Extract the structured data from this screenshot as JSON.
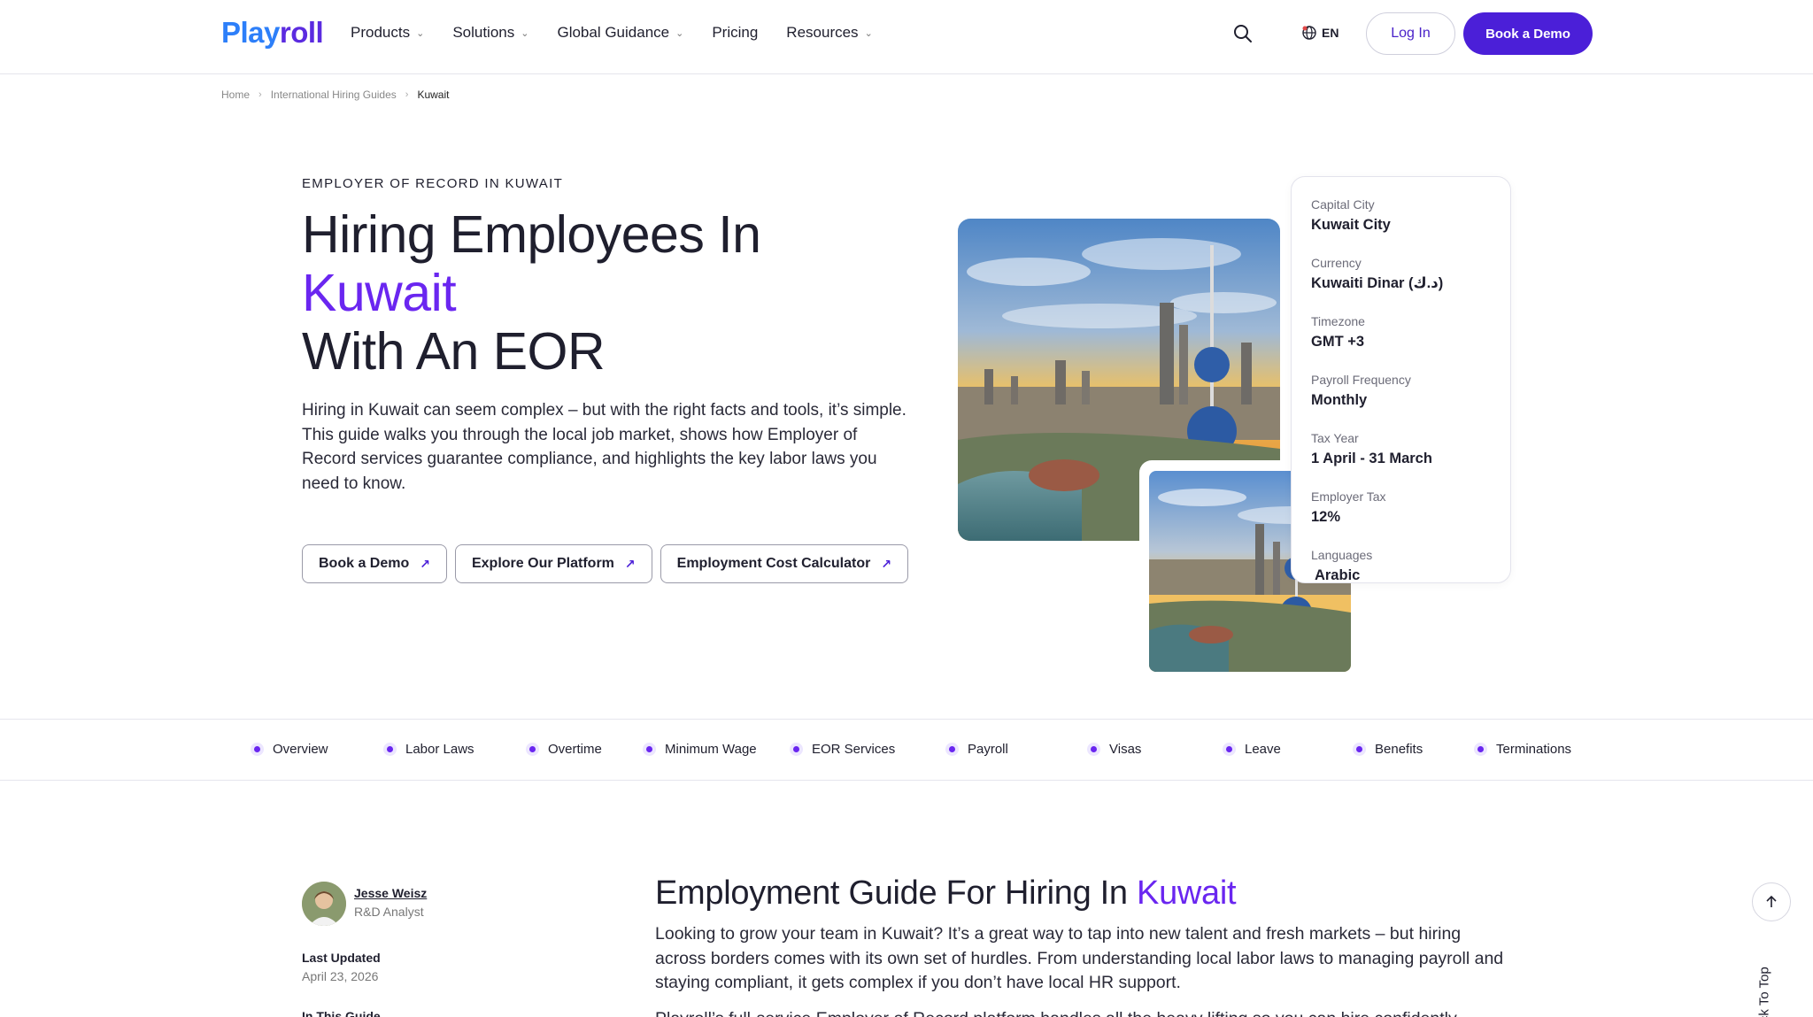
{
  "header": {
    "logo_play": "Play",
    "logo_roll": "roll",
    "nav": [
      {
        "label": "Products",
        "has_dropdown": true
      },
      {
        "label": "Solutions",
        "has_dropdown": true
      },
      {
        "label": "Global Guidance",
        "has_dropdown": true
      },
      {
        "label": "Pricing",
        "has_dropdown": false
      },
      {
        "label": "Resources",
        "has_dropdown": true
      }
    ],
    "language": "EN",
    "login_label": "Log In",
    "demo_label": "Book a Demo"
  },
  "breadcrumb": {
    "items": [
      "Home",
      "International Hiring Guides",
      "Kuwait"
    ]
  },
  "hero": {
    "eyebrow": "EMPLOYER OF RECORD IN KUWAIT",
    "title_line1": "Hiring Employees In",
    "title_accent": "Kuwait",
    "title_line3": "With An EOR",
    "description": "Hiring in Kuwait can seem complex – but with the right facts and tools, it’s simple. This guide walks you through the local job market, shows how Employer of Record services guarantee compliance, and highlights the key labor laws you need to know.",
    "buttons": [
      "Book a Demo",
      "Explore Our Platform",
      "Employment Cost Calculator"
    ]
  },
  "country_info": [
    {
      "label": "Capital City",
      "value": "Kuwait City"
    },
    {
      "label": "Currency",
      "value": "Kuwaiti Dinar (د.ك)"
    },
    {
      "label": "Timezone",
      "value": "GMT +3"
    },
    {
      "label": "Payroll Frequency",
      "value": "Monthly"
    },
    {
      "label": "Tax Year",
      "value": "1 April - 31 March"
    },
    {
      "label": "Employer Tax",
      "value": "12%"
    },
    {
      "label": "Languages",
      "value": " Arabic"
    }
  ],
  "tabs": [
    "Overview",
    "Labor Laws",
    "Overtime",
    "Minimum Wage",
    "EOR Services",
    "Payroll",
    "Visas",
    "Leave",
    "Benefits",
    "Terminations"
  ],
  "author": {
    "name": "Jesse Weisz",
    "role": "R&D Analyst",
    "updated_label": "Last Updated",
    "updated_date": "April 23, 2026",
    "in_this_guide": "In This Guide"
  },
  "guide": {
    "title_prefix": "Employment Guide For Hiring In ",
    "title_accent": "Kuwait",
    "paragraph1": "Looking to grow your team in Kuwait? It’s a great way to tap into new talent and fresh markets – but hiring across borders comes with its own set of hurdles. From understanding local labor laws to managing payroll and staying compliant, it gets complex if you don’t have local HR support.",
    "paragraph2": "Playroll’s full-service Employer of Record platform handles all the heavy lifting so you can hire confidently"
  },
  "back_to_top": "Back To Top",
  "colors": {
    "brand_purple": "#4b1fd8",
    "accent": "#6a26f0",
    "logo_blue": "#2d7ff9"
  }
}
